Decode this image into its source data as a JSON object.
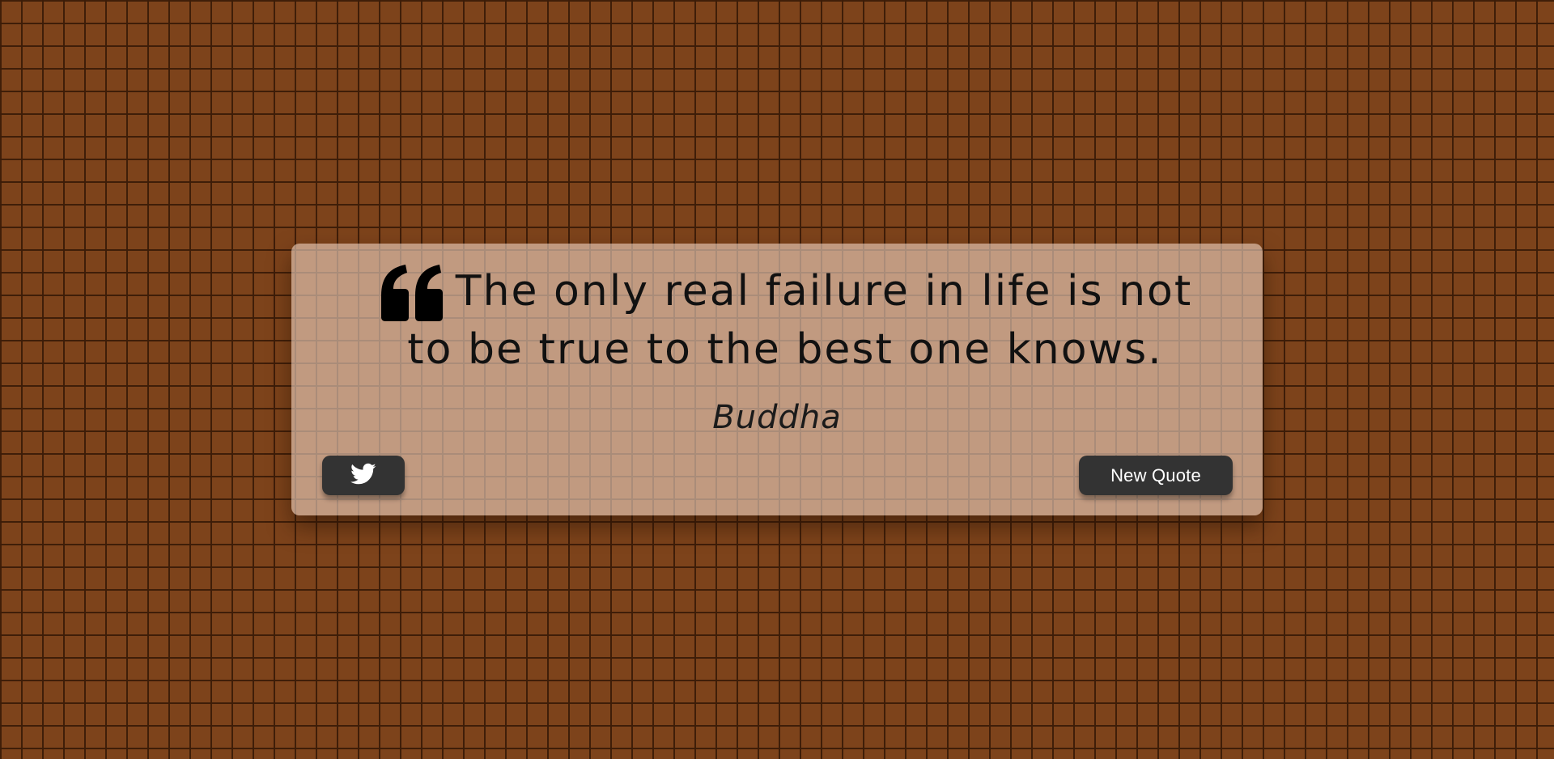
{
  "colors": {
    "wall_brick": "#7d431b",
    "wall_mortar": "#3c1c08",
    "card_overlay": "#ecd0be",
    "button_bg": "#333333",
    "button_text": "#ffffff",
    "quote_text": "#111111"
  },
  "quote": {
    "icon": "quote-left-icon",
    "text": "The only real failure in life is not to be true to the best one knows.",
    "author": "Buddha"
  },
  "actions": {
    "tweet_icon": "twitter-icon",
    "new_quote_label": "New Quote"
  }
}
